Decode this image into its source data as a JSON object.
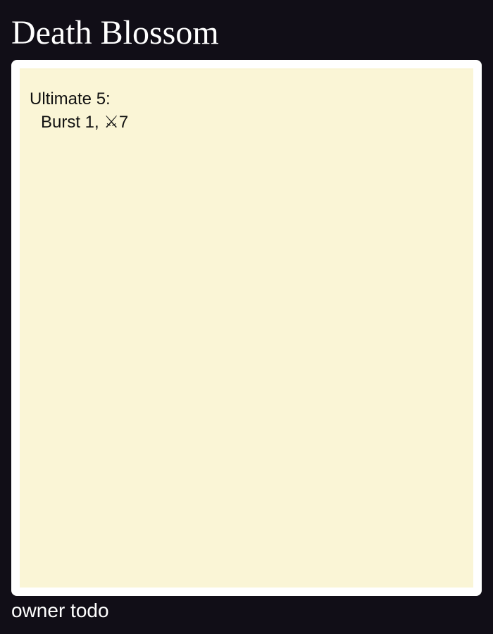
{
  "card": {
    "title": "Death Blossom",
    "ability": {
      "name": "Ultimate 5:",
      "effect": "Burst 1, ⚔7"
    },
    "owner": "owner todo",
    "colors": {
      "background": "#110e17",
      "frame": "#ffffff",
      "body": "#faf5d6"
    }
  }
}
